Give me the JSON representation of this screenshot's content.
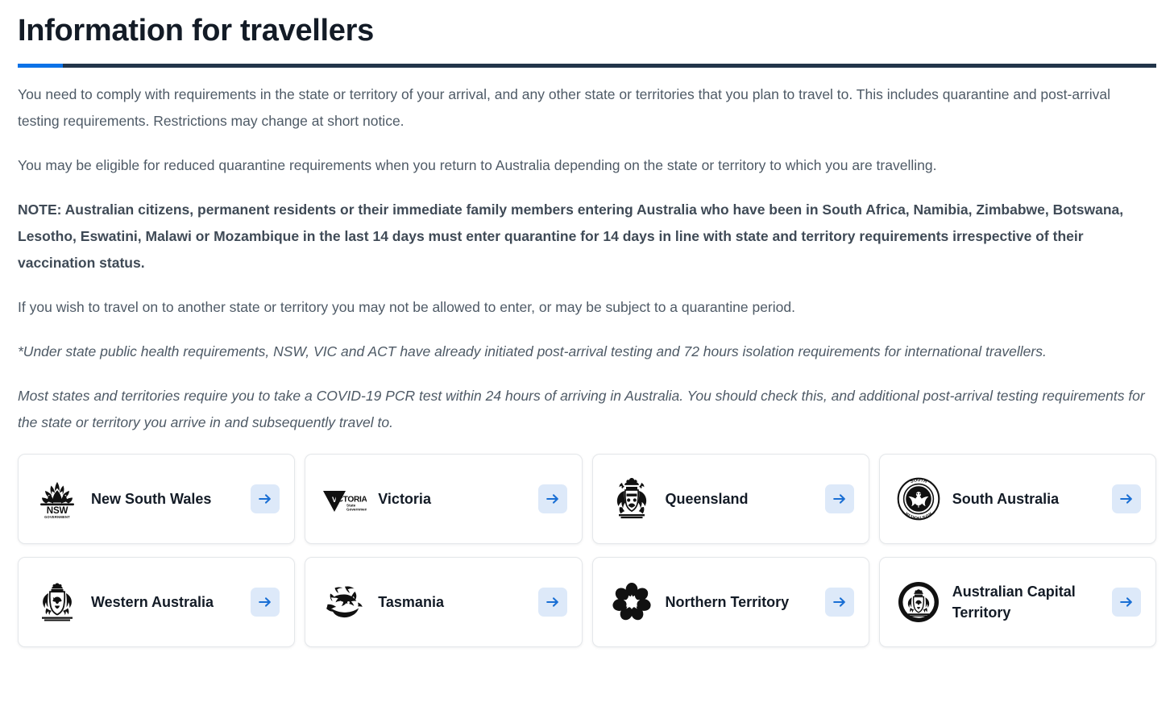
{
  "header": {
    "title": "Information for travellers",
    "accent_color": "#0b72e7",
    "rule_color": "#22354a"
  },
  "body_paragraphs": [
    {
      "id": "comply",
      "style": "normal",
      "text": "You need to comply with requirements in the state or territory of your arrival, and any other state or territories that you plan to travel to. This includes quarantine and post-arrival testing requirements. Restrictions may change at short notice."
    },
    {
      "id": "reduced-quarantine",
      "style": "normal",
      "text": "You may be eligible for reduced quarantine requirements when you return to Australia depending on the state or territory to which you are travelling."
    },
    {
      "id": "note",
      "style": "bold",
      "text": "NOTE: Australian citizens, permanent residents or their immediate family members entering Australia who have been in South Africa, Namibia, Zimbabwe, Botswana, Lesotho, Eswatini, Malawi or Mozambique in the last 14 days must enter quarantine for 14 days in line with state and territory requirements irrespective of their vaccination status."
    },
    {
      "id": "travel-on",
      "style": "normal",
      "text": "If you wish to travel on to another state or territory you may not be allowed to enter, or may be subject to a quarantine period."
    },
    {
      "id": "state-health-footnote",
      "style": "italic",
      "text": "*Under state public health requirements, NSW, VIC and ACT have already initiated post-arrival testing and 72 hours isolation requirements for international travellers."
    },
    {
      "id": "pcr-test",
      "style": "italic",
      "text": "Most states and territories require you to take a COVID-19 PCR test within 24 hours of arriving in Australia. You should check this, and additional post-arrival testing requirements for the state or territory you arrive in and subsequently travel to."
    }
  ],
  "cards": {
    "arrow_icon": "arrow-right-icon",
    "arrow_bg_color": "#dde9f9",
    "arrow_color": "#1a6fd4",
    "items": [
      {
        "id": "new-south-wales",
        "label": "New South Wales",
        "logo": "nsw-waratah-logo"
      },
      {
        "id": "victoria",
        "label": "Victoria",
        "logo": "victoria-triangle-logo"
      },
      {
        "id": "queensland",
        "label": "Queensland",
        "logo": "queensland-coat-of-arms-logo"
      },
      {
        "id": "south-australia",
        "label": "South Australia",
        "logo": "south-australia-circular-badge-logo"
      },
      {
        "id": "western-australia",
        "label": "Western Australia",
        "logo": "western-australia-coat-of-arms-logo"
      },
      {
        "id": "tasmania",
        "label": "Tasmania",
        "logo": "tasmania-devil-logo"
      },
      {
        "id": "northern-territory",
        "label": "Northern Territory",
        "logo": "northern-territory-desert-rose-logo"
      },
      {
        "id": "australian-capital-territory",
        "label": "Australian Capital Territory",
        "logo": "act-circular-coat-of-arms-logo"
      }
    ]
  }
}
